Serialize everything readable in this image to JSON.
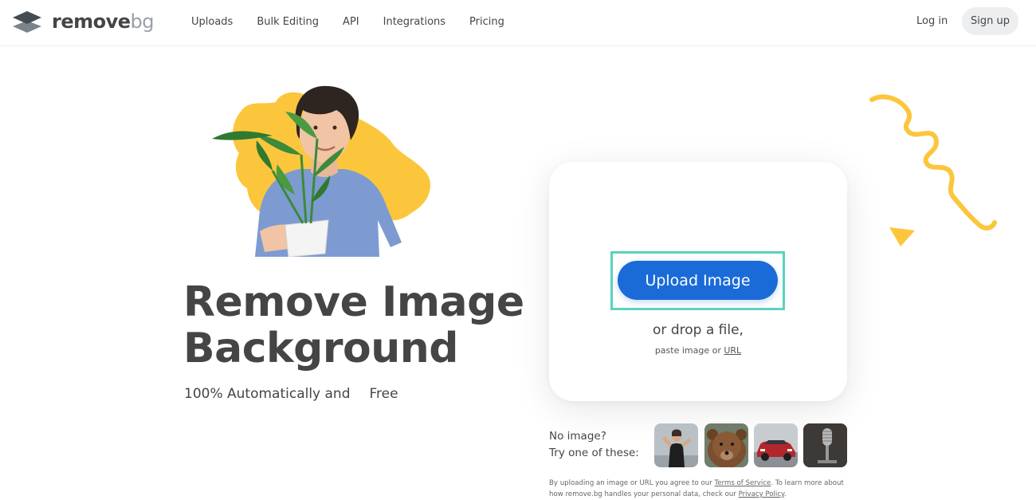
{
  "header": {
    "logo_primary": "remove",
    "logo_secondary": "bg",
    "nav": [
      "Uploads",
      "Bulk Editing",
      "API",
      "Integrations",
      "Pricing"
    ],
    "login": "Log in",
    "signup": "Sign up"
  },
  "hero": {
    "headline_line1": "Remove Image",
    "headline_line2": "Background",
    "subline": "100% Automatically and",
    "free_badge": "Free"
  },
  "upload": {
    "button": "Upload Image",
    "drop_text": "or drop a file,",
    "paste_prefix": "paste image or",
    "paste_url": "URL"
  },
  "samples": {
    "line1": "No image?",
    "line2": "Try one of these:",
    "thumbs": [
      "woman-sample",
      "bear-sample",
      "car-sample",
      "microphone-sample"
    ]
  },
  "legal": {
    "part1": "By uploading an image or URL you agree to our",
    "terms": "Terms of Service",
    "part2": ". To learn more about how remove.bg handles your personal data, check our",
    "privacy": "Privacy Policy",
    "part3": "."
  },
  "colors": {
    "accent": "#1a6bd8",
    "highlight": "#5ad2c0",
    "yellow": "#fcc63c",
    "text": "#454545"
  }
}
